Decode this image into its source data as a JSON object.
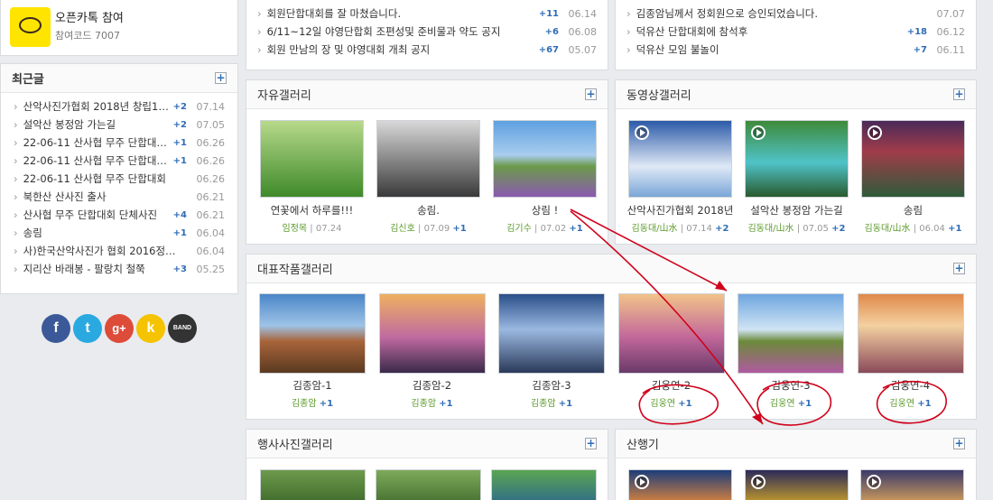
{
  "openchat": {
    "title": "오픈카톡 참여",
    "code": "참여코드 7007"
  },
  "recent": {
    "title": "최근글",
    "items": [
      {
        "t": "산악사진가협회 2018년 창립10…",
        "c": "+2",
        "d": "07.14"
      },
      {
        "t": "설악산 봉정암 가는길",
        "c": "+2",
        "d": "07.05"
      },
      {
        "t": "22-06-11 산사협 무주 단합대…",
        "c": "+1",
        "d": "06.26"
      },
      {
        "t": "22-06-11 산사협 무주 단합대…",
        "c": "+1",
        "d": "06.26"
      },
      {
        "t": "22-06-11 산사협 무주 단합대회",
        "c": "",
        "d": "06.26"
      },
      {
        "t": "북한산 산사진 출사",
        "c": "",
        "d": "06.21"
      },
      {
        "t": "산사협 무주 단합대회 단체사진",
        "c": "+4",
        "d": "06.21"
      },
      {
        "t": "송림",
        "c": "+1",
        "d": "06.04"
      },
      {
        "t": "사)한국산악사진가 협회 2016정…",
        "c": "",
        "d": "06.04"
      },
      {
        "t": "지리산 바래봉 - 팔랑치 철쭉",
        "c": "+3",
        "d": "05.25"
      }
    ]
  },
  "social": {
    "facebook": "f",
    "twitter": "t",
    "google": "g+",
    "kakao": "k",
    "band": "BAND"
  },
  "notice_left": [
    {
      "t": "회원단합대회를 잘 마쳤습니다.",
      "c": "+11",
      "d": "06.14"
    },
    {
      "t": "6/11~12일 야영단합회 조편성및 준비물과 약도 공지",
      "c": "+6",
      "d": "06.08"
    },
    {
      "t": "회원 만남의 장 및 야영대회 개최 공지",
      "c": "+67",
      "d": "05.07"
    }
  ],
  "notice_right": [
    {
      "t": "김종암님께서 정회원으로 승인되었습니다.",
      "c": "",
      "d": "07.07"
    },
    {
      "t": "덕유산 단합대회에 참석후",
      "c": "+18",
      "d": "06.12"
    },
    {
      "t": "덕유산 모임 불놀이",
      "c": "+7",
      "d": "06.11"
    }
  ],
  "free_gallery": {
    "title": "자유갤러리",
    "items": [
      {
        "cap": "연꽃에서 하루를!!!",
        "author": "임정목",
        "date": "07.24",
        "cnt": ""
      },
      {
        "cap": "송림.",
        "author": "김신호",
        "date": "07.09",
        "cnt": "+1"
      },
      {
        "cap": "상림 !",
        "author": "김기수",
        "date": "07.02",
        "cnt": "+1"
      }
    ]
  },
  "video_gallery": {
    "title": "동영상갤러리",
    "items": [
      {
        "cap": "산악사진가협회 2018년",
        "author": "김동대/山水",
        "date": "07.14",
        "cnt": "+2"
      },
      {
        "cap": "설악산 봉정암 가는길",
        "author": "김동대/山水",
        "date": "07.05",
        "cnt": "+2"
      },
      {
        "cap": "송림",
        "author": "김동대/山水",
        "date": "06.04",
        "cnt": "+1"
      }
    ]
  },
  "rep_gallery": {
    "title": "대표작품갤러리",
    "items": [
      {
        "cap": "김종암-1",
        "author": "김종암",
        "cnt": "+1"
      },
      {
        "cap": "김종암-2",
        "author": "김종암",
        "cnt": "+1"
      },
      {
        "cap": "김종암-3",
        "author": "김종암",
        "cnt": "+1"
      },
      {
        "cap": "김웅연-2",
        "author": "김웅연",
        "cnt": "+1"
      },
      {
        "cap": "김웅연-3",
        "author": "김웅연",
        "cnt": "+1"
      },
      {
        "cap": "김웅연-4",
        "author": "김웅연",
        "cnt": "+1"
      }
    ]
  },
  "event_gallery": {
    "title": "행사사진갤러리"
  },
  "hiking": {
    "title": "산행기"
  },
  "colors": {
    "accent": "#2f6db5",
    "author": "#5a9a2a",
    "annotation": "#d0021b"
  }
}
